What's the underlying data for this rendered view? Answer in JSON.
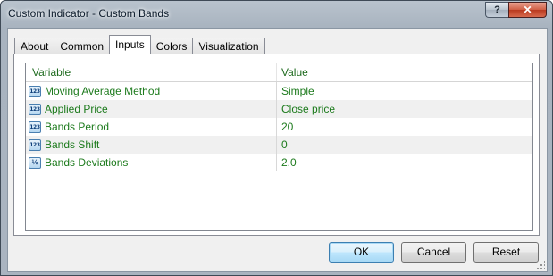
{
  "window": {
    "title": "Custom Indicator - Custom Bands",
    "help_glyph": "?",
    "close_glyph": "✕"
  },
  "tabs": [
    {
      "label": "About"
    },
    {
      "label": "Common"
    },
    {
      "label": "Inputs",
      "active": true
    },
    {
      "label": "Colors"
    },
    {
      "label": "Visualization"
    }
  ],
  "table": {
    "headers": {
      "variable": "Variable",
      "value": "Value"
    },
    "rows": [
      {
        "icon": "123",
        "icon_name": "integer-type-icon",
        "variable": "Moving Average Method",
        "value": "Simple"
      },
      {
        "icon": "123",
        "icon_name": "integer-type-icon",
        "variable": "Applied Price",
        "value": "Close price"
      },
      {
        "icon": "123",
        "icon_name": "integer-type-icon",
        "variable": "Bands Period",
        "value": "20"
      },
      {
        "icon": "123",
        "icon_name": "integer-type-icon",
        "variable": "Bands Shift",
        "value": "0"
      },
      {
        "icon": "½",
        "icon_name": "double-type-icon",
        "variable": "Bands Deviations",
        "value": "2.0"
      }
    ]
  },
  "buttons": {
    "ok": "OK",
    "cancel": "Cancel",
    "reset": "Reset"
  },
  "colors": {
    "value_text": "#1c7a1c",
    "accent_border": "#3c7fb1"
  }
}
